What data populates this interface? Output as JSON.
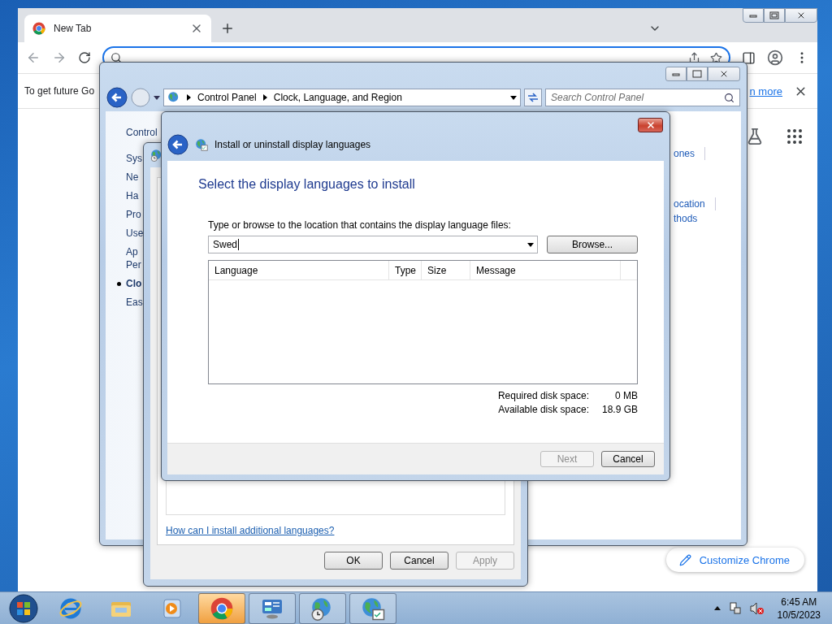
{
  "chrome": {
    "tabs": [
      {
        "title": "New Tab",
        "selected": true
      }
    ],
    "infobar": {
      "text": "To get future Go",
      "link": "n more"
    },
    "customize_button": "Customize Chrome"
  },
  "control_panel": {
    "breadcrumb": [
      "Control Panel",
      "Clock, Language, and Region"
    ],
    "search": {
      "placeholder": "Search Control Panel"
    },
    "sidebar": {
      "title": "Control",
      "items": [
        {
          "label": "Sys",
          "selected": false
        },
        {
          "label": "Ne",
          "selected": false
        },
        {
          "label": "Ha",
          "selected": false
        },
        {
          "label": "Pro",
          "selected": false
        },
        {
          "label": "Use",
          "selected": false
        },
        {
          "label": "Ap\nPer",
          "selected": false
        },
        {
          "label": "Clo",
          "selected": true
        },
        {
          "label": "Eas",
          "selected": false
        }
      ]
    },
    "task_groups": [
      [
        "ones"
      ],
      [
        "ocation",
        "thods"
      ]
    ]
  },
  "region_dialog": {
    "link": "How can I install additional languages?",
    "buttons": [
      {
        "label": "OK",
        "disabled": false
      },
      {
        "label": "Cancel",
        "disabled": false
      },
      {
        "label": "Apply",
        "disabled": true
      }
    ]
  },
  "install_dialog": {
    "title": "Install or uninstall display languages",
    "heading": "Select the display languages to install",
    "location_label": "Type or browse to the location that contains the display language files:",
    "location": {
      "value": "Swed"
    },
    "browse_button": "Browse...",
    "table": {
      "columns": [
        "Language",
        "Type",
        "Size",
        "Message"
      ]
    },
    "disk": [
      {
        "label": "Required disk space:",
        "value": "0 MB"
      },
      {
        "label": "Available disk space:",
        "value": "18.9 GB"
      }
    ],
    "buttons": [
      {
        "label": "Next",
        "disabled": true
      },
      {
        "label": "Cancel",
        "disabled": false
      }
    ]
  },
  "taskbar": {
    "items": [
      {
        "kind": "ie",
        "running": false,
        "selected": false
      },
      {
        "kind": "explorer",
        "running": false,
        "selected": false
      },
      {
        "kind": "media",
        "running": false,
        "selected": false
      },
      {
        "kind": "chrome",
        "running": true,
        "selected": true
      },
      {
        "kind": "control",
        "running": true,
        "selected": false
      },
      {
        "kind": "clockglobe",
        "running": true,
        "selected": false
      },
      {
        "kind": "langglobe",
        "running": true,
        "selected": false
      }
    ],
    "clock": {
      "time": "6:45 AM",
      "date": "10/5/2023"
    }
  }
}
